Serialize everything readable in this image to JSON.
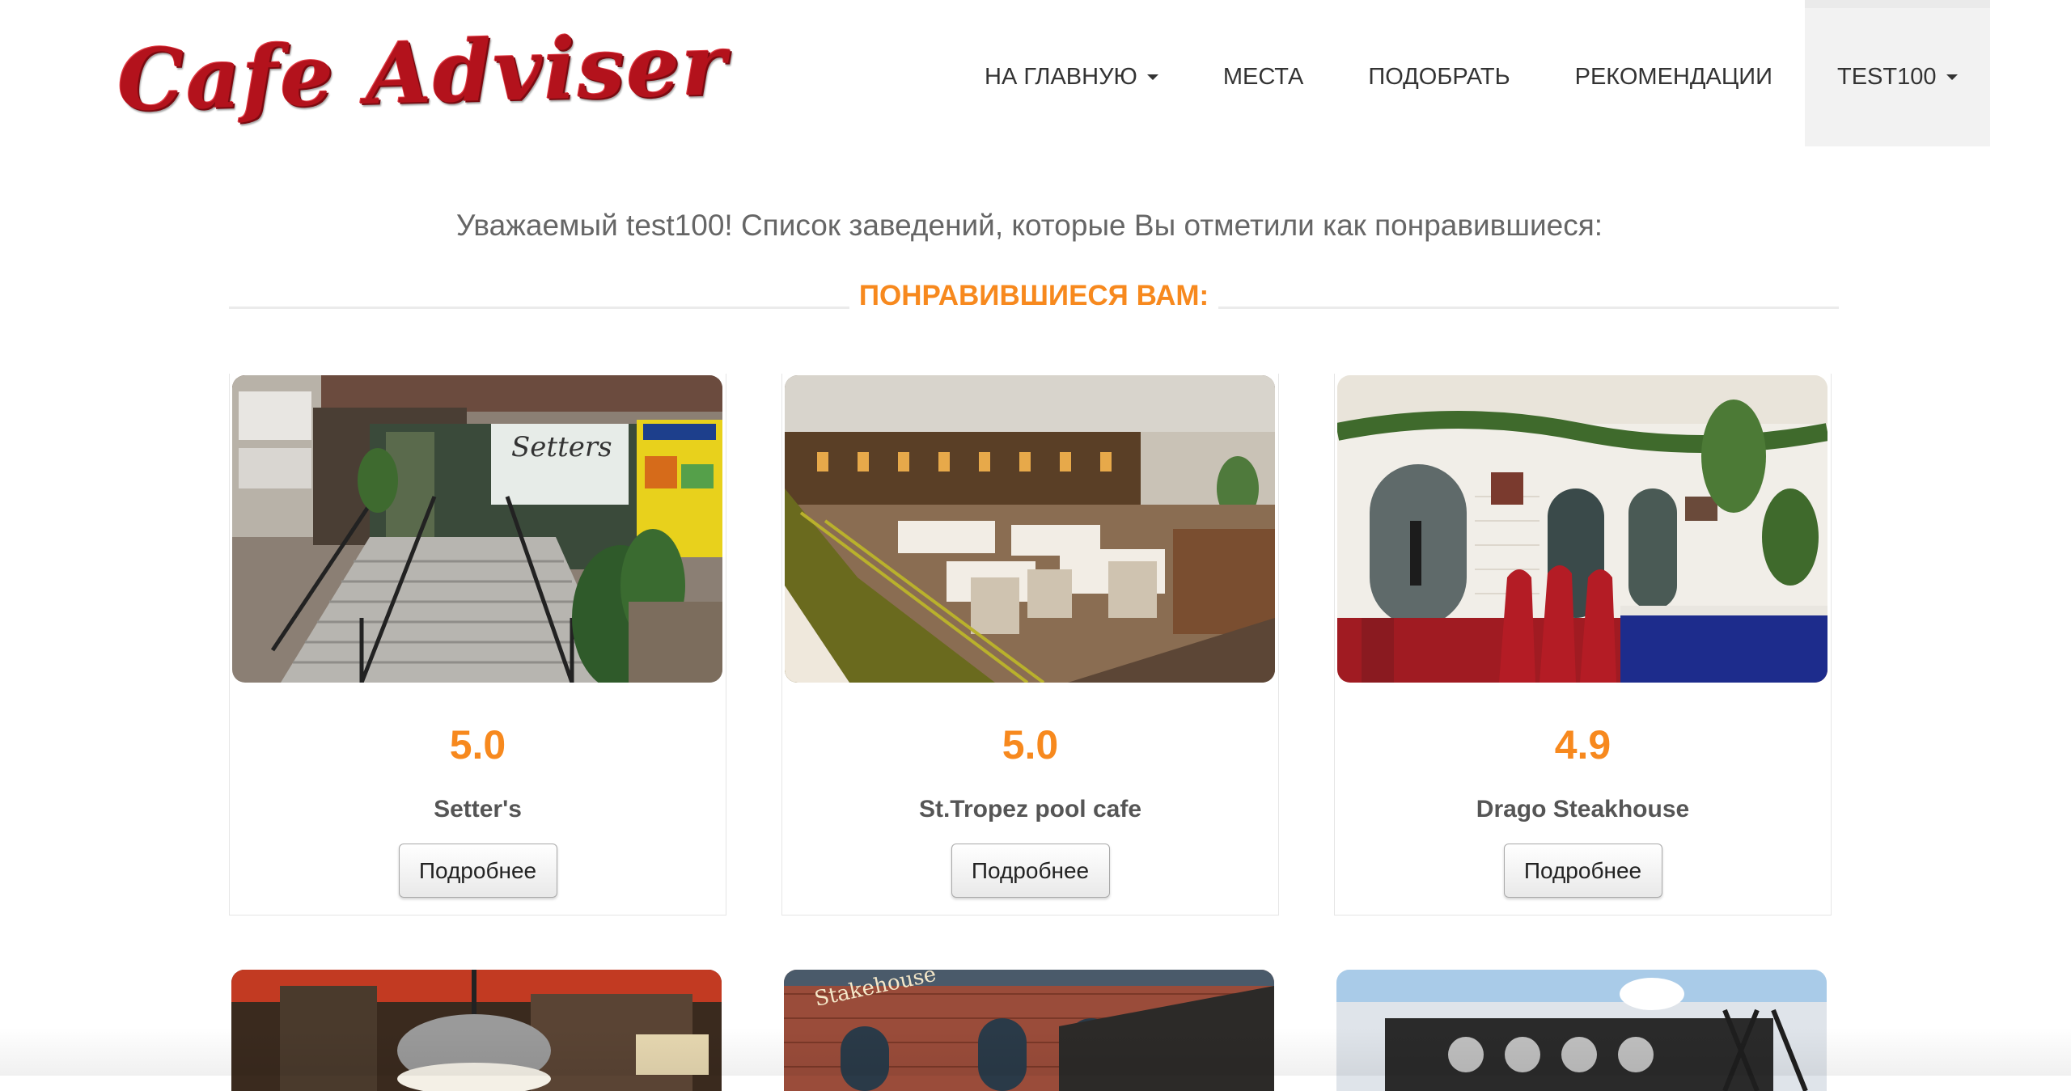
{
  "brand": {
    "logo_text": "Cafe Adviser"
  },
  "nav": {
    "items": [
      {
        "label": "НА ГЛАВНУЮ",
        "dropdown": true
      },
      {
        "label": "МЕСТА"
      },
      {
        "label": "ПОДОБРАТЬ"
      },
      {
        "label": "РЕКОМЕНДАЦИИ"
      },
      {
        "label": "TEST100",
        "dropdown": true,
        "active": true
      }
    ]
  },
  "intro": "Уважаемый test100! Список заведений, которые Вы отметили как понравившиеся:",
  "section_title": "ПОНРАВИВШИЕСЯ ВАМ:",
  "button_label": "Подробнее",
  "colors": {
    "accent": "#f7891e",
    "logo": "#b3121c"
  },
  "places": [
    {
      "rating": "5.0",
      "name": "Setter's"
    },
    {
      "rating": "5.0",
      "name": "St.Tropez pool cafe"
    },
    {
      "rating": "4.9",
      "name": "Drago Steakhouse"
    }
  ]
}
